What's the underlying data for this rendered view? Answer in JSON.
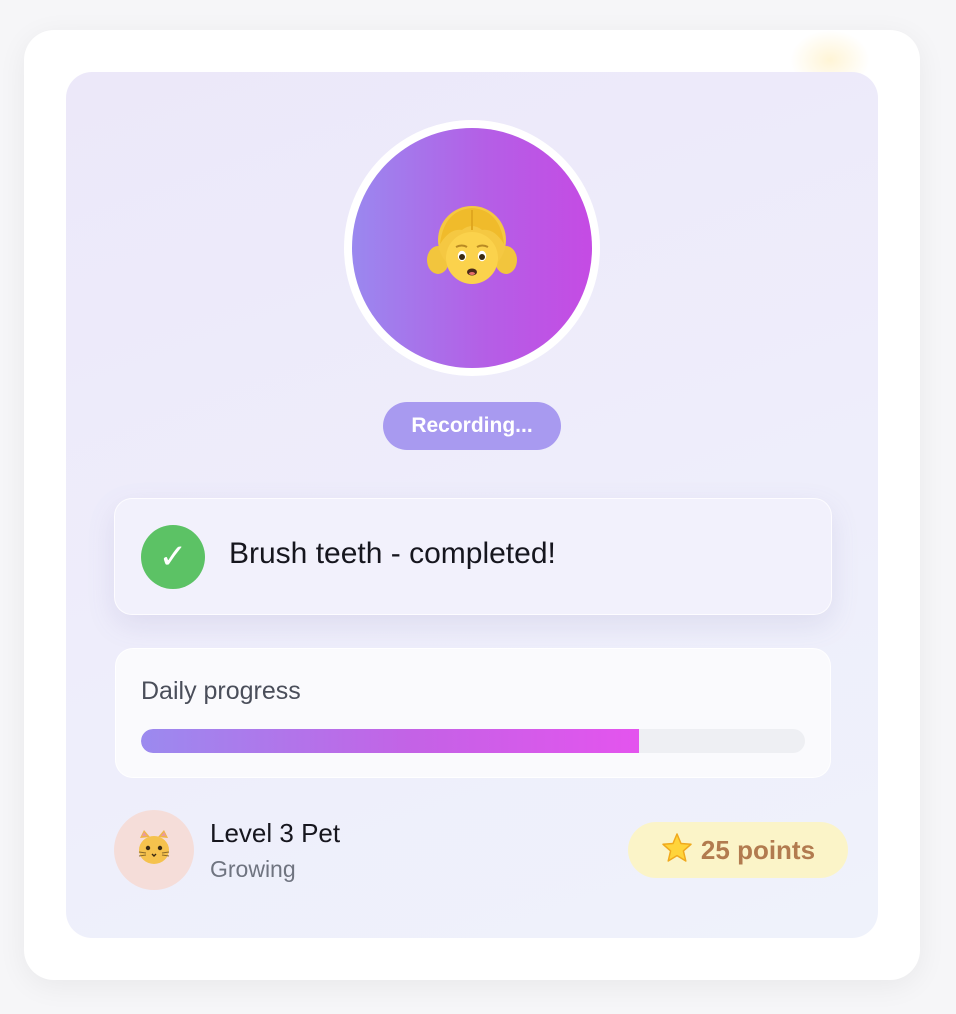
{
  "recording": {
    "label": "Recording..."
  },
  "task": {
    "text": "Brush teeth - completed!",
    "check_symbol": "✓",
    "status_color": "#5cc265"
  },
  "progress": {
    "label": "Daily progress",
    "value_percent": 75
  },
  "pet": {
    "title": "Level 3 Pet",
    "subtitle": "Growing",
    "icon": "cat-face-icon"
  },
  "points": {
    "label": "25 points",
    "icon": "star-icon"
  },
  "avatar": {
    "icon": "girl-face-icon"
  },
  "colors": {
    "accent_start": "#9a88ef",
    "accent_end": "#c54be4",
    "progress_end": "#e454ee",
    "points_bg": "#fbf4c8",
    "points_text": "#b27b4f"
  }
}
